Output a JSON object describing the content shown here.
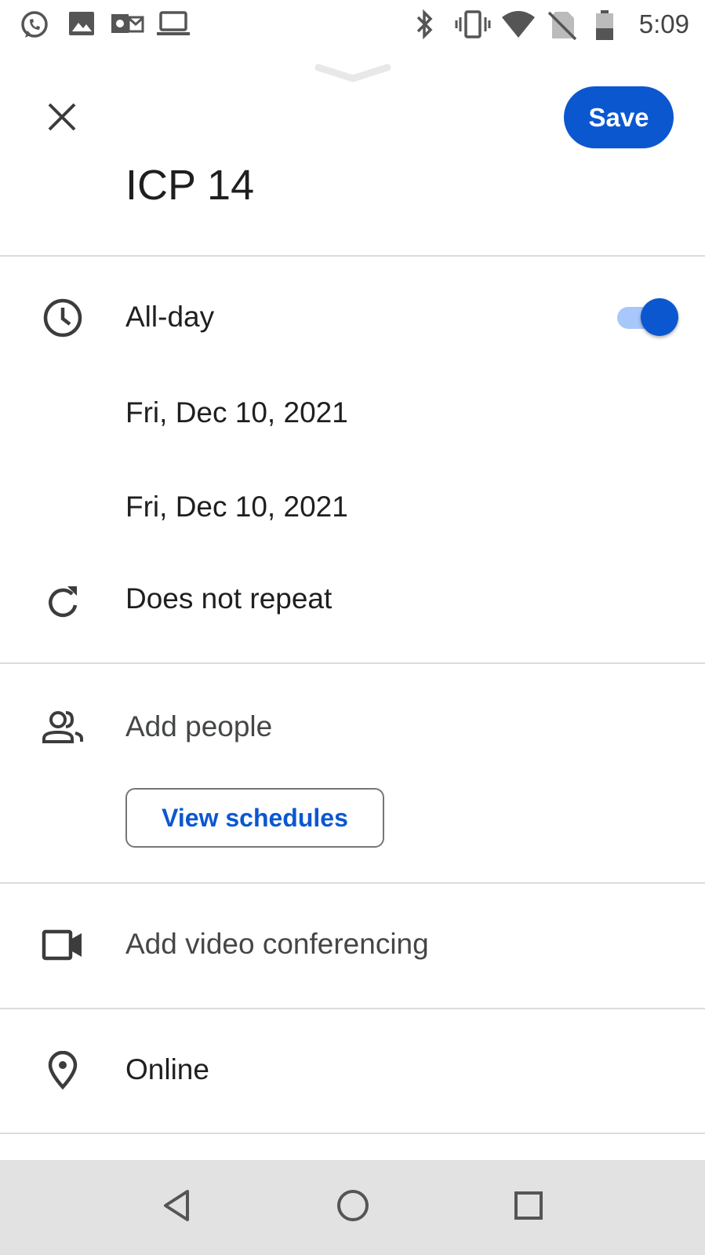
{
  "status_bar": {
    "time": "5:09",
    "left_icons": [
      "whatsapp-icon",
      "gallery-icon",
      "outlook-icon",
      "laptop-icon"
    ],
    "right_icons": [
      "bluetooth-icon",
      "vibrate-icon",
      "wifi-icon",
      "no-sim-icon",
      "battery-icon"
    ]
  },
  "header": {
    "save_label": "Save",
    "title": "ICP 14"
  },
  "event": {
    "all_day_label": "All-day",
    "all_day_on": true,
    "start_date": "Fri, Dec 10, 2021",
    "end_date": "Fri, Dec 10, 2021",
    "repeat": "Does not repeat"
  },
  "people": {
    "add_people": "Add people",
    "view_schedules": "View schedules"
  },
  "conferencing": {
    "label": "Add video conferencing"
  },
  "location": {
    "value": "Online"
  },
  "colors": {
    "accent": "#0b57d0",
    "toggle_track": "#a8c7fa",
    "divider": "#dadce0",
    "nav_bar": "#e1e2e1"
  }
}
